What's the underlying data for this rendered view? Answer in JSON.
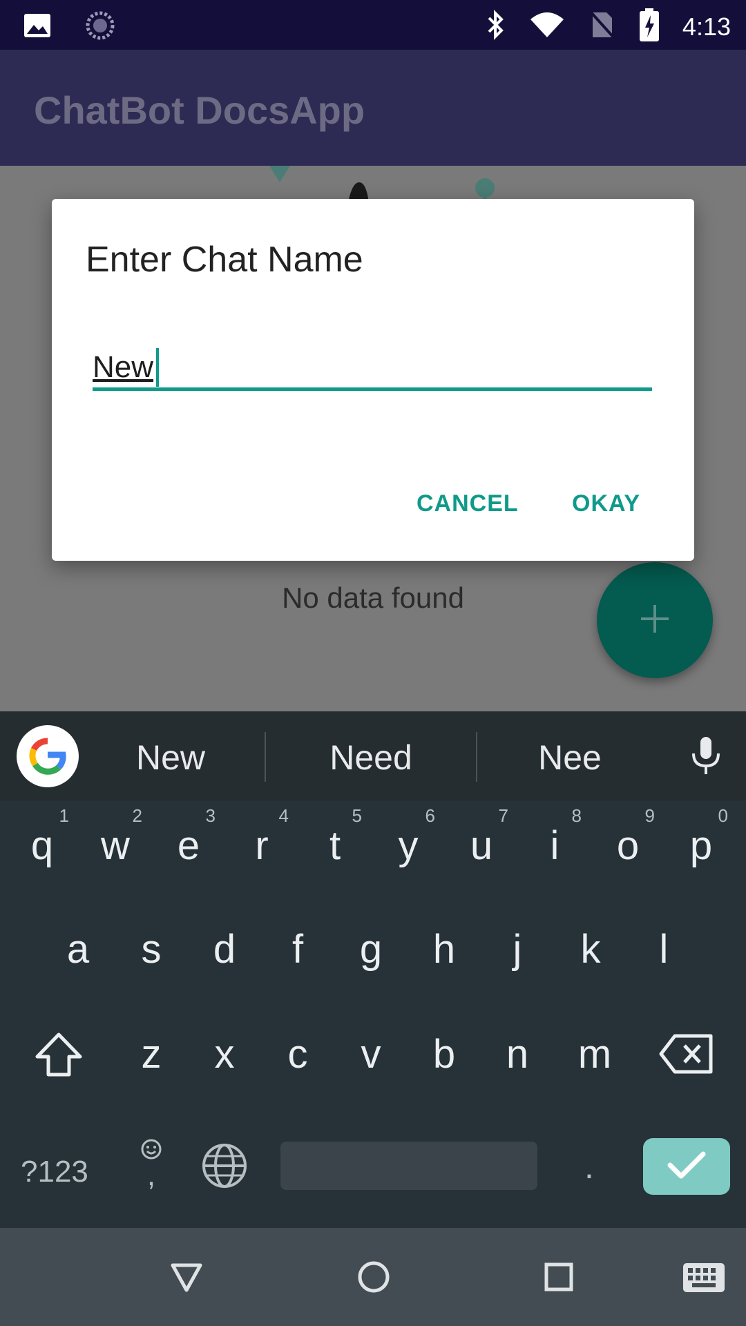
{
  "status_bar": {
    "time": "4:13",
    "icons": [
      "image-icon",
      "loading-icon",
      "bluetooth-icon",
      "wifi-icon",
      "no-sim-icon",
      "battery-charging-icon"
    ]
  },
  "app_bar": {
    "title": "ChatBot DocsApp"
  },
  "main": {
    "empty_message": "No data found",
    "fab_icon": "plus-icon"
  },
  "dialog": {
    "title": "Enter Chat Name",
    "input_value": "New",
    "cancel_label": "CANCEL",
    "okay_label": "OKAY"
  },
  "keyboard": {
    "suggestions": [
      "New",
      "Need",
      "Nee"
    ],
    "row1": [
      {
        "key": "q",
        "hint": "1"
      },
      {
        "key": "w",
        "hint": "2"
      },
      {
        "key": "e",
        "hint": "3"
      },
      {
        "key": "r",
        "hint": "4"
      },
      {
        "key": "t",
        "hint": "5"
      },
      {
        "key": "y",
        "hint": "6"
      },
      {
        "key": "u",
        "hint": "7"
      },
      {
        "key": "i",
        "hint": "8"
      },
      {
        "key": "o",
        "hint": "9"
      },
      {
        "key": "p",
        "hint": "0"
      }
    ],
    "row2": [
      "a",
      "s",
      "d",
      "f",
      "g",
      "h",
      "j",
      "k",
      "l"
    ],
    "row3": [
      "z",
      "x",
      "c",
      "v",
      "b",
      "n",
      "m"
    ],
    "symbols_label": "?123",
    "period_label": ".",
    "emoji_comma_label": ","
  },
  "colors": {
    "accent": "#0f9a8a",
    "status_bar": "#140f3a",
    "app_bar": "#2d2a54",
    "fab": "#045b50",
    "keyboard_bg": "#263238",
    "enter_key": "#7fcbc4"
  }
}
